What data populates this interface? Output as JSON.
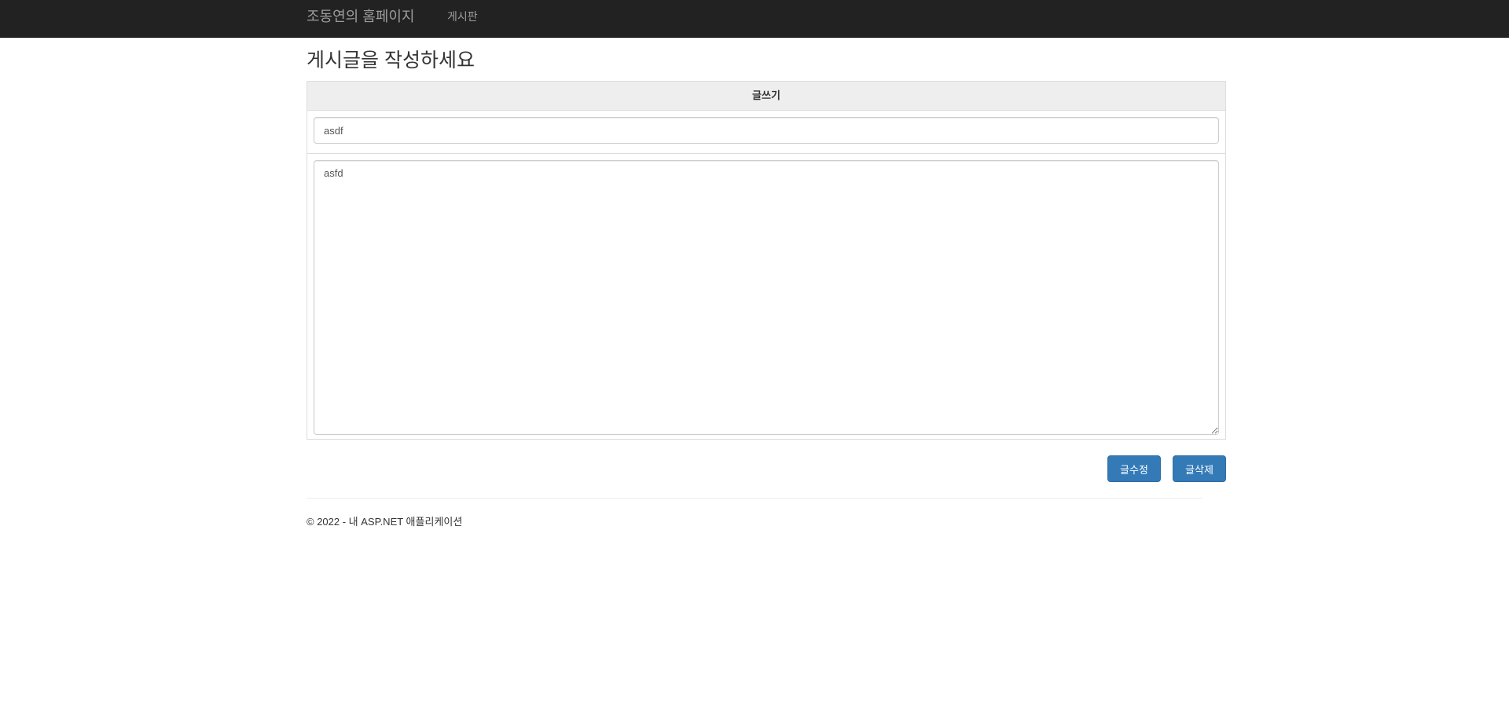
{
  "navbar": {
    "brand": "조동연의 홈페이지",
    "links": [
      {
        "label": "게시판"
      }
    ]
  },
  "page": {
    "title": "게시글을 작성하세요"
  },
  "form": {
    "header": "글쓰기",
    "title_value": "asdf",
    "body_value": "asfd"
  },
  "actions": {
    "edit_label": "글수정",
    "delete_label": "글삭제"
  },
  "footer": {
    "text": "© 2022 - 내 ASP.NET 애플리케이션"
  },
  "colors": {
    "navbar_bg": "#222222",
    "navbar_text": "#9d9d9d",
    "primary_button": "#337ab7"
  }
}
